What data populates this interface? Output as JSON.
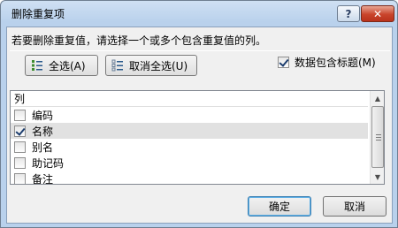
{
  "dialog": {
    "title": "删除重复项",
    "help_label": "?",
    "close_label": "✕",
    "instruction": "若要删除重复值，请选择一个或多个包含重复值的列。",
    "select_all_label": "全选(A)",
    "deselect_all_label": "取消全选(U)",
    "header_checkbox": {
      "label": "数据包含标题(M)",
      "checked": true
    },
    "ok_label": "确定",
    "cancel_label": "取消"
  },
  "list": {
    "header": "列",
    "items": [
      {
        "label": "编码",
        "checked": false
      },
      {
        "label": "名称",
        "checked": true
      },
      {
        "label": "别名",
        "checked": false
      },
      {
        "label": "助记码",
        "checked": false
      },
      {
        "label": "备注",
        "checked": false
      }
    ]
  },
  "icons": {
    "help": "help-icon",
    "close": "close-icon",
    "select_all": "select-all-icon",
    "deselect_all": "deselect-all-icon",
    "scroll_up": "scroll-up-icon",
    "scroll_down": "scroll-down-icon"
  }
}
